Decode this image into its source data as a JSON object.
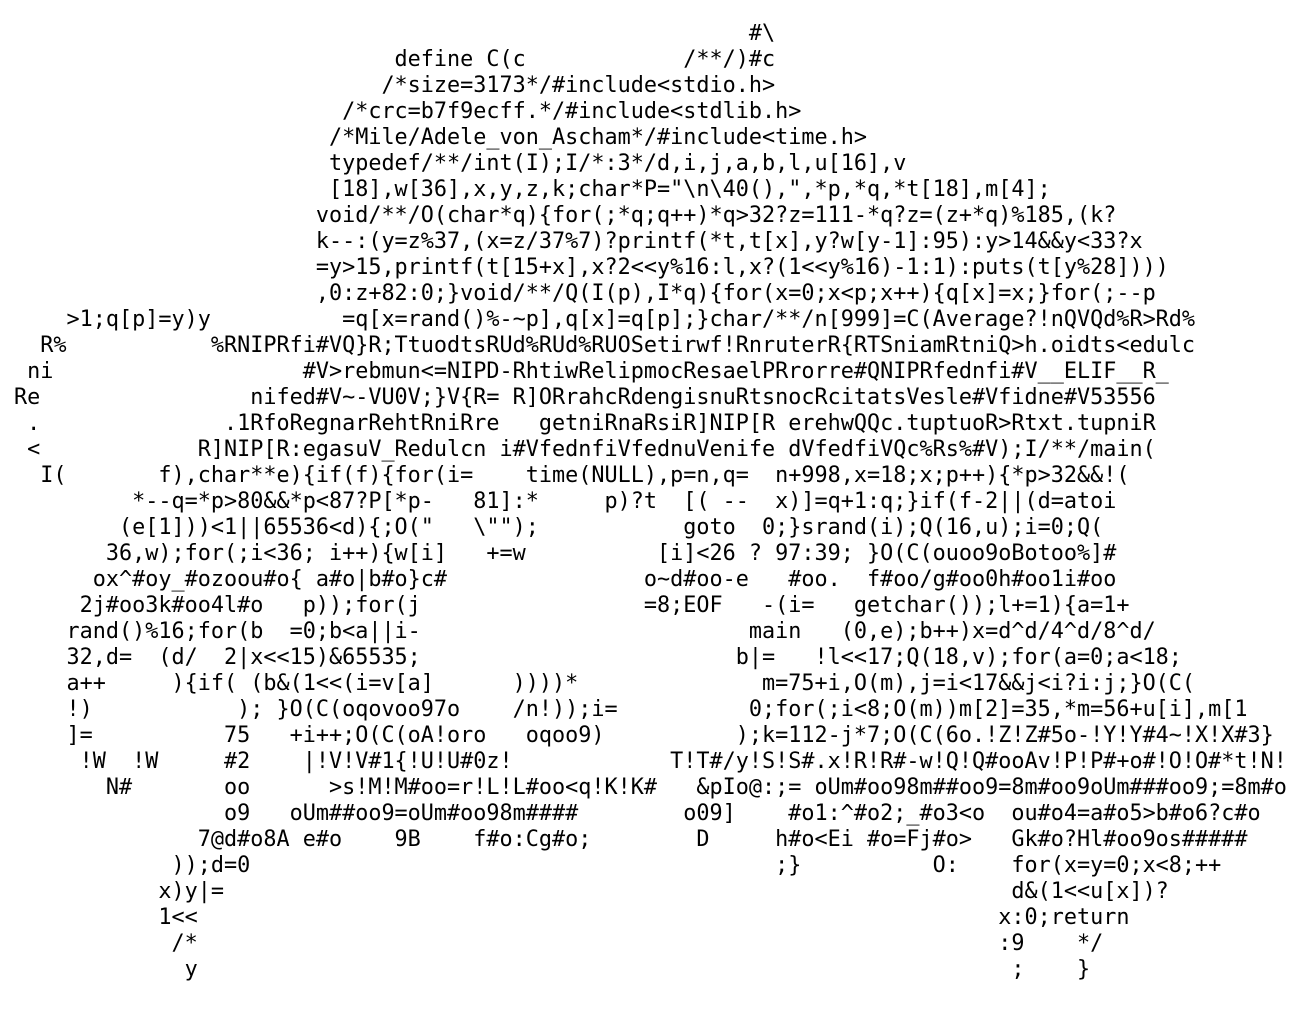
{
  "code": {
    "lines": [
      "                                                        #\\",
      "                             define C(c            /**/)#c",
      "                            /*size=3173*/#include<stdio.h>",
      "                         /*crc=b7f9ecff.*/#include<stdlib.h>",
      "                        /*Mile/Adele_von_Ascham*/#include<time.h>",
      "                        typedef/**/int(I);I/*:3*/d,i,j,a,b,l,u[16],v",
      "                        [18],w[36],x,y,z,k;char*P=\"\\n\\40(),\",*p,*q,*t[18],m[4];",
      "                       void/**/O(char*q){for(;*q;q++)*q>32?z=111-*q?z=(z+*q)%185,(k?",
      "                       k--:(y=z%37,(x=z/37%7)?printf(*t,t[x],y?w[y-1]:95):y>14&&y<33?x",
      "                       =y>15,printf(t[15+x],x?2<<y%16:l,x?(1<<y%16)-1:1):puts(t[y%28])))",
      "                       ,0:z+82:0;}void/**/Q(I(p),I*q){for(x=0;x<p;x++){q[x]=x;}for(;--p",
      "    >1;q[p]=y)y          =q[x=rand()%-~p],q[x]=q[p];}char/**/n[999]=C(Average?!nQVQd%R>Rd%",
      "  R%           %RNIPRfi#VQ}R;TtuodtsRUd%RUd%RUOSetirwf!RnruterR{RTSniamRtniQ>h.oidts<edulc",
      " ni                   #V>rebmun<=NIPD-RhtiwRelipmocResaelPRrorre#QNIPRfednfi#V__ELIF__R_",
      "Re                nifed#V~-VU0V;}V{R= R]ORrahcRdengisnuRtsnocRcitatsVesle#Vfidne#V53556",
      " .              .1RfoRegnarRehtRniRre   getniRnaRsiR]NIP[R erehwQQc.tuptuoR>Rtxt.tupniR",
      " <            R]NIP[R:egasuV_Redulcn i#VfednfiVfednuVenife dVfedfiVQc%Rs%#V);I/**/main(",
      "  I(       f),char**e){if(f){for(i=    time(NULL),p=n,q=  n+998,x=18;x;p++){*p>32&&!(",
      "         *--q=*p>80&&*p<87?P[*p-   81]:*     p)?t  [( --  x)]=q+1:q;}if(f-2||(d=atoi",
      "        (e[1]))<1||65536<d){;O(\"   \\\"\");           goto  0;}srand(i);Q(16,u);i=0;Q(",
      "       36,w);for(;i<36; i++){w[i]   +=w          [i]<26 ? 97:39; }O(C(ouoo9oBotoo%]#",
      "      ox^#oy_#ozoou#o{ a#o|b#o}c#               o~d#oo-e   #oo.  f#oo/g#oo0h#oo1i#oo",
      "     2j#oo3k#oo4l#o   p));for(j                 =8;EOF   -(i=   getchar());l+=1){a=1+",
      "    rand()%16;for(b  =0;b<a||i-                         main   (0,e);b++)x=d^d/4^d/8^d/",
      "    32,d=  (d/  2|x<<15)&65535;                        b|=   !l<<17;Q(18,v);for(a=0;a<18;",
      "    a++     ){if( (b&(1<<(i=v[a]      ))))*              m=75+i,O(m),j=i<17&&j<i?i:j;}O(C(",
      "    !)           ); }O(C(oqovoo97o    /n!));i=          0;for(;i<8;O(m))m[2]=35,*m=56+u[i],m[1",
      "    ]=          75   +i++;O(C(oA!oro   oqoo9)          );k=112-j*7;O(C(6o.!Z!Z#5o-!Y!Y#4~!X!X#3}",
      "     !W  !W     #2    |!V!V#1{!U!U#0z!            T!T#/y!S!S#.x!R!R#-w!Q!Q#ooAv!P!P#+o#!O!O#*t!N!",
      "       N#       oo      >s!M!M#oo=r!L!L#oo<q!K!K#   &pIo@:;= oUm#oo98m##oo9=8m#oo9oUm###oo9;=8m#o",
      "                o9   oUm##oo9=oUm#oo98m####        o09]    #o1:^#o2;_#o3<o  ou#o4=a#o5>b#o6?c#o",
      "              7@d#o8A e#o    9B    f#o:Cg#o;        D     h#o<Ei #o=Fj#o>   Gk#o?Hl#oo9os#####",
      "            ));d=0                                        ;}          O:    for(x=y=0;x<8;++",
      "           x)y|=                                                            d&(1<<u[x])?",
      "           1<<                                                             x:0;return",
      "            /*                                                             :9    */",
      "             y                                                              ;    }"
    ]
  }
}
